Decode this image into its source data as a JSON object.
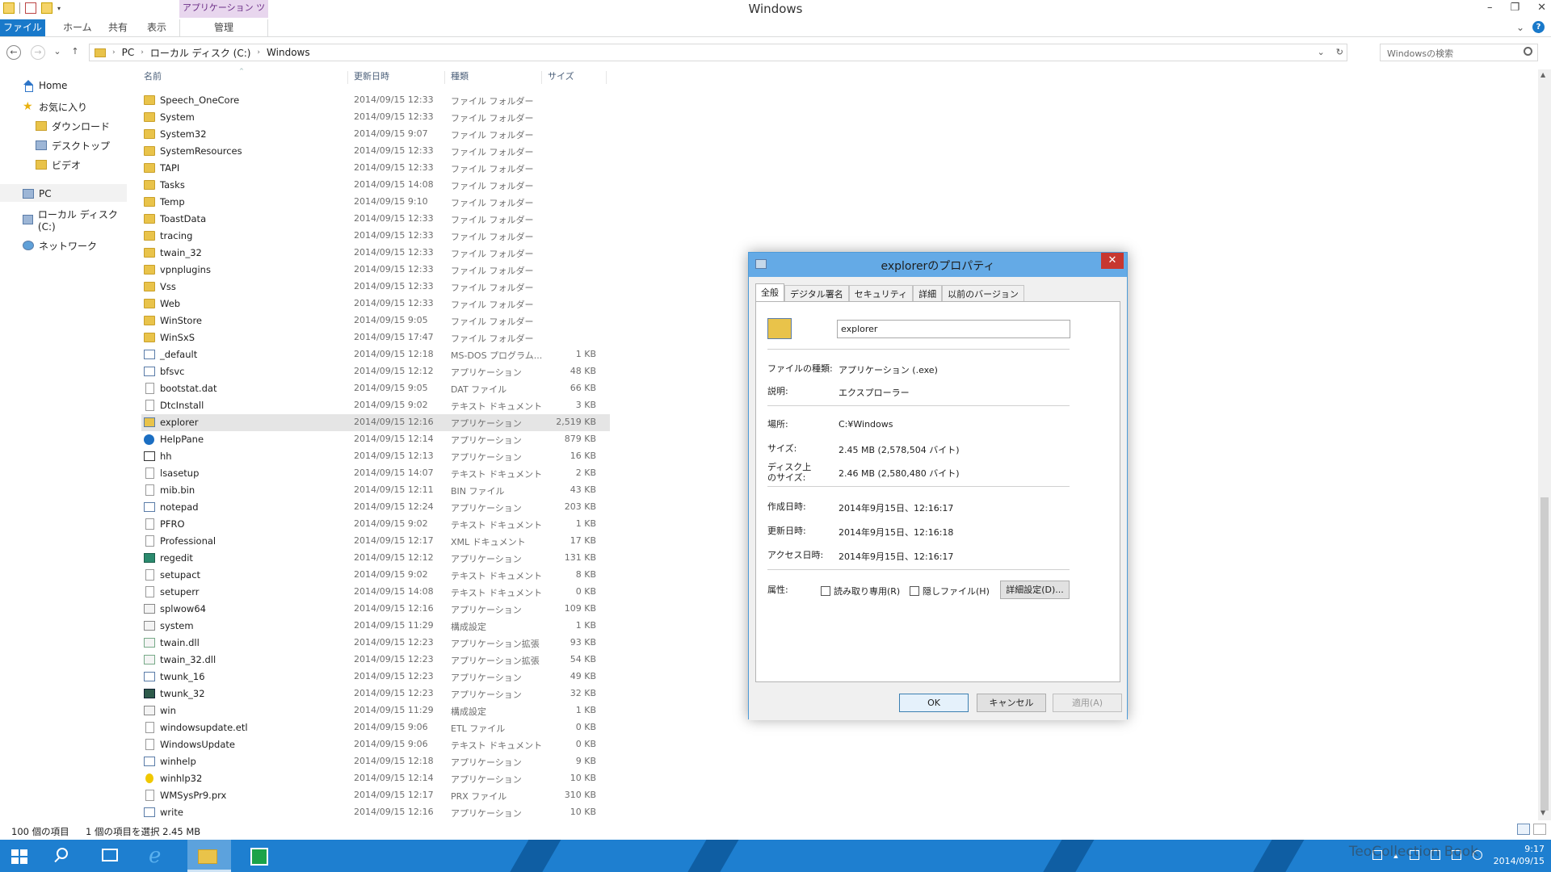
{
  "window": {
    "title": "Windows",
    "tool_tab": "アプリケーション ツール",
    "controls": [
      "–",
      "❐",
      "✕"
    ]
  },
  "ribbon": {
    "tabs": [
      "ファイル",
      "ホーム",
      "共有",
      "表示",
      "管理"
    ],
    "help_glyph": "?",
    "expand_glyph": "⌄"
  },
  "nav": {
    "back": "←",
    "forward": "→",
    "recent": "⌄",
    "up": "↑",
    "crumbs": [
      "PC",
      "ローカル ディスク (C:)",
      "Windows"
    ],
    "crumb_separator": "›",
    "dropdown": "⌄",
    "refresh": "↻",
    "search_placeholder": "Windowsの検索"
  },
  "navpane": {
    "items": [
      {
        "label": "Home",
        "icon": "home-icon"
      },
      {
        "label": "お気に入り",
        "icon": "star-icon"
      },
      {
        "label": "ダウンロード",
        "icon": "download-folder-icon"
      },
      {
        "label": "デスクトップ",
        "icon": "desktop-icon"
      },
      {
        "label": "ビデオ",
        "icon": "video-folder-icon"
      },
      {
        "label": "PC",
        "icon": "pc-icon"
      },
      {
        "label": "ローカル ディスク (C:)",
        "icon": "drive-icon"
      },
      {
        "label": "ネットワーク",
        "icon": "network-icon"
      }
    ]
  },
  "filelist": {
    "headers": {
      "name": "名前",
      "date": "更新日時",
      "type": "種類",
      "size": "サイズ"
    },
    "sort_glyph": "^",
    "rows": [
      {
        "name": "Speech_OneCore",
        "date": "2014/09/15 12:33",
        "type": "ファイル フォルダー",
        "size": "",
        "icon": "folder"
      },
      {
        "name": "System",
        "date": "2014/09/15 12:33",
        "type": "ファイル フォルダー",
        "size": "",
        "icon": "folder"
      },
      {
        "name": "System32",
        "date": "2014/09/15 9:07",
        "type": "ファイル フォルダー",
        "size": "",
        "icon": "folder"
      },
      {
        "name": "SystemResources",
        "date": "2014/09/15 12:33",
        "type": "ファイル フォルダー",
        "size": "",
        "icon": "folder"
      },
      {
        "name": "TAPI",
        "date": "2014/09/15 12:33",
        "type": "ファイル フォルダー",
        "size": "",
        "icon": "folder"
      },
      {
        "name": "Tasks",
        "date": "2014/09/15 14:08",
        "type": "ファイル フォルダー",
        "size": "",
        "icon": "folder"
      },
      {
        "name": "Temp",
        "date": "2014/09/15 9:10",
        "type": "ファイル フォルダー",
        "size": "",
        "icon": "folder"
      },
      {
        "name": "ToastData",
        "date": "2014/09/15 12:33",
        "type": "ファイル フォルダー",
        "size": "",
        "icon": "folder"
      },
      {
        "name": "tracing",
        "date": "2014/09/15 12:33",
        "type": "ファイル フォルダー",
        "size": "",
        "icon": "folder"
      },
      {
        "name": "twain_32",
        "date": "2014/09/15 12:33",
        "type": "ファイル フォルダー",
        "size": "",
        "icon": "folder"
      },
      {
        "name": "vpnplugins",
        "date": "2014/09/15 12:33",
        "type": "ファイル フォルダー",
        "size": "",
        "icon": "folder"
      },
      {
        "name": "Vss",
        "date": "2014/09/15 12:33",
        "type": "ファイル フォルダー",
        "size": "",
        "icon": "folder"
      },
      {
        "name": "Web",
        "date": "2014/09/15 12:33",
        "type": "ファイル フォルダー",
        "size": "",
        "icon": "folder"
      },
      {
        "name": "WinStore",
        "date": "2014/09/15 9:05",
        "type": "ファイル フォルダー",
        "size": "",
        "icon": "folder"
      },
      {
        "name": "WinSxS",
        "date": "2014/09/15 17:47",
        "type": "ファイル フォルダー",
        "size": "",
        "icon": "folder"
      },
      {
        "name": "_default",
        "date": "2014/09/15 12:18",
        "type": "MS-DOS プログラム...",
        "size": "1 KB",
        "icon": "app"
      },
      {
        "name": "bfsvc",
        "date": "2014/09/15 12:12",
        "type": "アプリケーション",
        "size": "48 KB",
        "icon": "app"
      },
      {
        "name": "bootstat.dat",
        "date": "2014/09/15 9:05",
        "type": "DAT ファイル",
        "size": "66 KB",
        "icon": "text"
      },
      {
        "name": "DtcInstall",
        "date": "2014/09/15 9:02",
        "type": "テキスト ドキュメント",
        "size": "3 KB",
        "icon": "text"
      },
      {
        "name": "explorer",
        "date": "2014/09/15 12:16",
        "type": "アプリケーション",
        "size": "2,519 KB",
        "icon": "exp",
        "selected": true
      },
      {
        "name": "HelpPane",
        "date": "2014/09/15 12:14",
        "type": "アプリケーション",
        "size": "879 KB",
        "icon": "help"
      },
      {
        "name": "hh",
        "date": "2014/09/15 12:13",
        "type": "アプリケーション",
        "size": "16 KB",
        "icon": "hh"
      },
      {
        "name": "lsasetup",
        "date": "2014/09/15 14:07",
        "type": "テキスト ドキュメント",
        "size": "2 KB",
        "icon": "text"
      },
      {
        "name": "mib.bin",
        "date": "2014/09/15 12:11",
        "type": "BIN ファイル",
        "size": "43 KB",
        "icon": "text"
      },
      {
        "name": "notepad",
        "date": "2014/09/15 12:24",
        "type": "アプリケーション",
        "size": "203 KB",
        "icon": "app"
      },
      {
        "name": "PFRO",
        "date": "2014/09/15 9:02",
        "type": "テキスト ドキュメント",
        "size": "1 KB",
        "icon": "text"
      },
      {
        "name": "Professional",
        "date": "2014/09/15 12:17",
        "type": "XML ドキュメント",
        "size": "17 KB",
        "icon": "text"
      },
      {
        "name": "regedit",
        "date": "2014/09/15 12:12",
        "type": "アプリケーション",
        "size": "131 KB",
        "icon": "reg"
      },
      {
        "name": "setupact",
        "date": "2014/09/15 9:02",
        "type": "テキスト ドキュメント",
        "size": "8 KB",
        "icon": "text"
      },
      {
        "name": "setuperr",
        "date": "2014/09/15 14:08",
        "type": "テキスト ドキュメント",
        "size": "0 KB",
        "icon": "text"
      },
      {
        "name": "splwow64",
        "date": "2014/09/15 12:16",
        "type": "アプリケーション",
        "size": "109 KB",
        "icon": "cfg"
      },
      {
        "name": "system",
        "date": "2014/09/15 11:29",
        "type": "構成設定",
        "size": "1 KB",
        "icon": "cfg"
      },
      {
        "name": "twain.dll",
        "date": "2014/09/15 12:23",
        "type": "アプリケーション拡張",
        "size": "93 KB",
        "icon": "dll"
      },
      {
        "name": "twain_32.dll",
        "date": "2014/09/15 12:23",
        "type": "アプリケーション拡張",
        "size": "54 KB",
        "icon": "dll"
      },
      {
        "name": "twunk_16",
        "date": "2014/09/15 12:23",
        "type": "アプリケーション",
        "size": "49 KB",
        "icon": "app"
      },
      {
        "name": "twunk_32",
        "date": "2014/09/15 12:23",
        "type": "アプリケーション",
        "size": "32 KB",
        "icon": "dark"
      },
      {
        "name": "win",
        "date": "2014/09/15 11:29",
        "type": "構成設定",
        "size": "1 KB",
        "icon": "cfg"
      },
      {
        "name": "windowsupdate.etl",
        "date": "2014/09/15 9:06",
        "type": "ETL ファイル",
        "size": "0 KB",
        "icon": "text"
      },
      {
        "name": "WindowsUpdate",
        "date": "2014/09/15 9:06",
        "type": "テキスト ドキュメント",
        "size": "0 KB",
        "icon": "text"
      },
      {
        "name": "winhelp",
        "date": "2014/09/15 12:18",
        "type": "アプリケーション",
        "size": "9 KB",
        "icon": "app"
      },
      {
        "name": "winhlp32",
        "date": "2014/09/15 12:14",
        "type": "アプリケーション",
        "size": "10 KB",
        "icon": "key"
      },
      {
        "name": "WMSysPr9.prx",
        "date": "2014/09/15 12:17",
        "type": "PRX ファイル",
        "size": "310 KB",
        "icon": "text"
      },
      {
        "name": "write",
        "date": "2014/09/15 12:16",
        "type": "アプリケーション",
        "size": "10 KB",
        "icon": "app"
      }
    ]
  },
  "scrollbar": {
    "up": "▲",
    "down": "▼"
  },
  "status": {
    "count": "100 個の項目",
    "selection": "1 個の項目を選択  2.45 MB"
  },
  "dialog": {
    "title": "explorerのプロパティ",
    "close": "✕",
    "tabs": [
      "全般",
      "デジタル署名",
      "セキュリティ",
      "詳細",
      "以前のバージョン"
    ],
    "name_value": "explorer",
    "fields": {
      "type_label": "ファイルの種類:",
      "type_value": "アプリケーション (.exe)",
      "desc_label": "説明:",
      "desc_value": "エクスプローラー",
      "location_label": "場所:",
      "location_value": "C:¥Windows",
      "size_label": "サイズ:",
      "size_value": "2.45 MB (2,578,504 バイト)",
      "disk_label_1": "ディスク上",
      "disk_label_2": "のサイズ:",
      "disk_value": "2.46 MB (2,580,480 バイト)",
      "created_label": "作成日時:",
      "created_value": "2014年9月15日、12:16:17",
      "modified_label": "更新日時:",
      "modified_value": "2014年9月15日、12:16:18",
      "accessed_label": "アクセス日時:",
      "accessed_value": "2014年9月15日、12:16:17",
      "attr_label": "属性:",
      "readonly": "読み取り専用(R)",
      "hidden": "隠しファイル(H)",
      "advanced": "詳細設定(D)..."
    },
    "buttons": {
      "ok": "OK",
      "cancel": "キャンセル",
      "apply": "適用(A)"
    }
  },
  "taskbar": {
    "ie_glyph": "e",
    "tray_arrow": "▴",
    "time": "9:17",
    "date": "2014/09/15",
    "watermark": "TeoCollection Book"
  }
}
